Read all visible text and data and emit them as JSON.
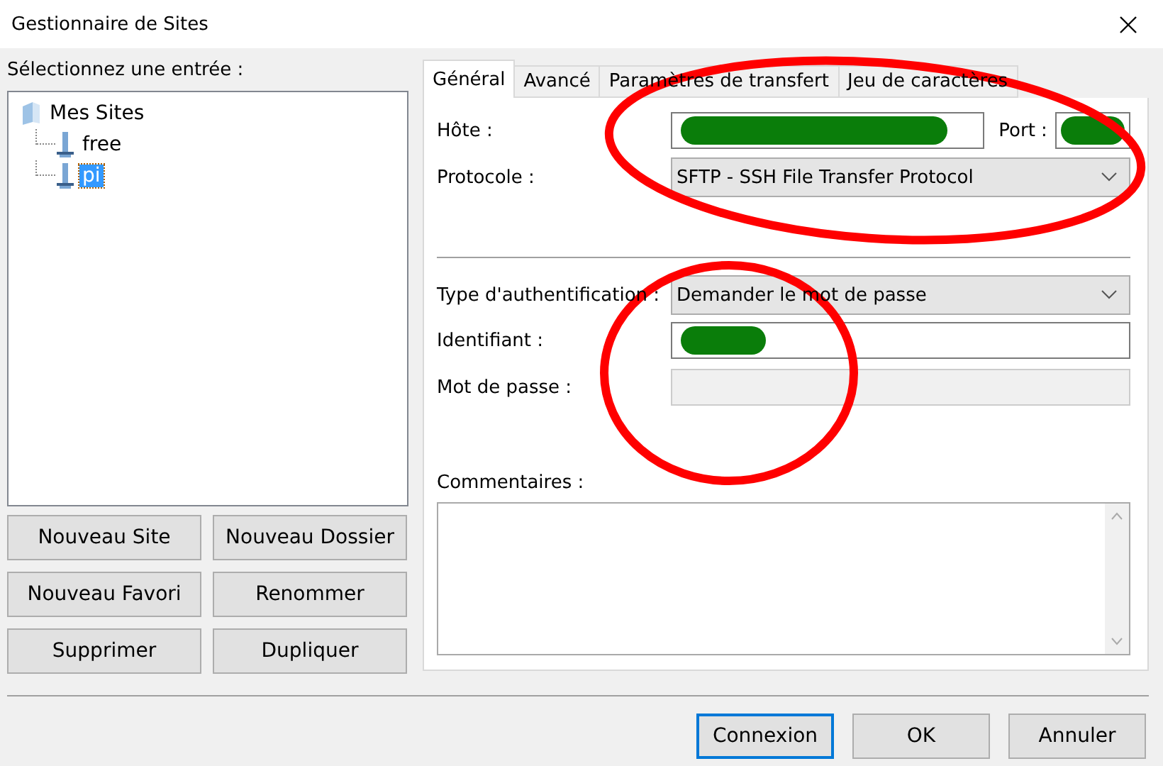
{
  "window": {
    "title": "Gestionnaire de Sites"
  },
  "tree": {
    "label": "Sélectionnez une entrée :",
    "items": [
      {
        "label": "Mes Sites",
        "kind": "folder",
        "selected": false,
        "children": [
          {
            "label": "free",
            "kind": "site",
            "selected": false
          },
          {
            "label": "pi",
            "kind": "site",
            "selected": true
          }
        ]
      }
    ]
  },
  "left_buttons": [
    "Nouveau Site",
    "Nouveau Dossier",
    "Nouveau Favori",
    "Renommer",
    "Supprimer",
    "Dupliquer"
  ],
  "tabs": [
    {
      "label": "Général",
      "selected": true
    },
    {
      "label": "Avancé",
      "selected": false
    },
    {
      "label": "Paramètres de transfert",
      "selected": false
    },
    {
      "label": "Jeu de caractères",
      "selected": false
    }
  ],
  "host": {
    "label": "Hôte :",
    "redacted": true
  },
  "port": {
    "label": "Port :",
    "redacted": true
  },
  "protocol": {
    "label": "Protocole :",
    "value": "SFTP - SSH File Transfer Protocol"
  },
  "auth_type": {
    "label": "Type d'authentification :",
    "value": "Demander le mot de passe"
  },
  "user": {
    "label": "Identifiant :",
    "redacted": true
  },
  "password": {
    "label": "Mot de passe :",
    "disabled": true
  },
  "comments": {
    "label": "Commentaires :"
  },
  "buttons": [
    {
      "label": "Connexion",
      "default": true
    },
    {
      "label": "OK",
      "default": false
    },
    {
      "label": "Annuler",
      "default": false
    }
  ]
}
